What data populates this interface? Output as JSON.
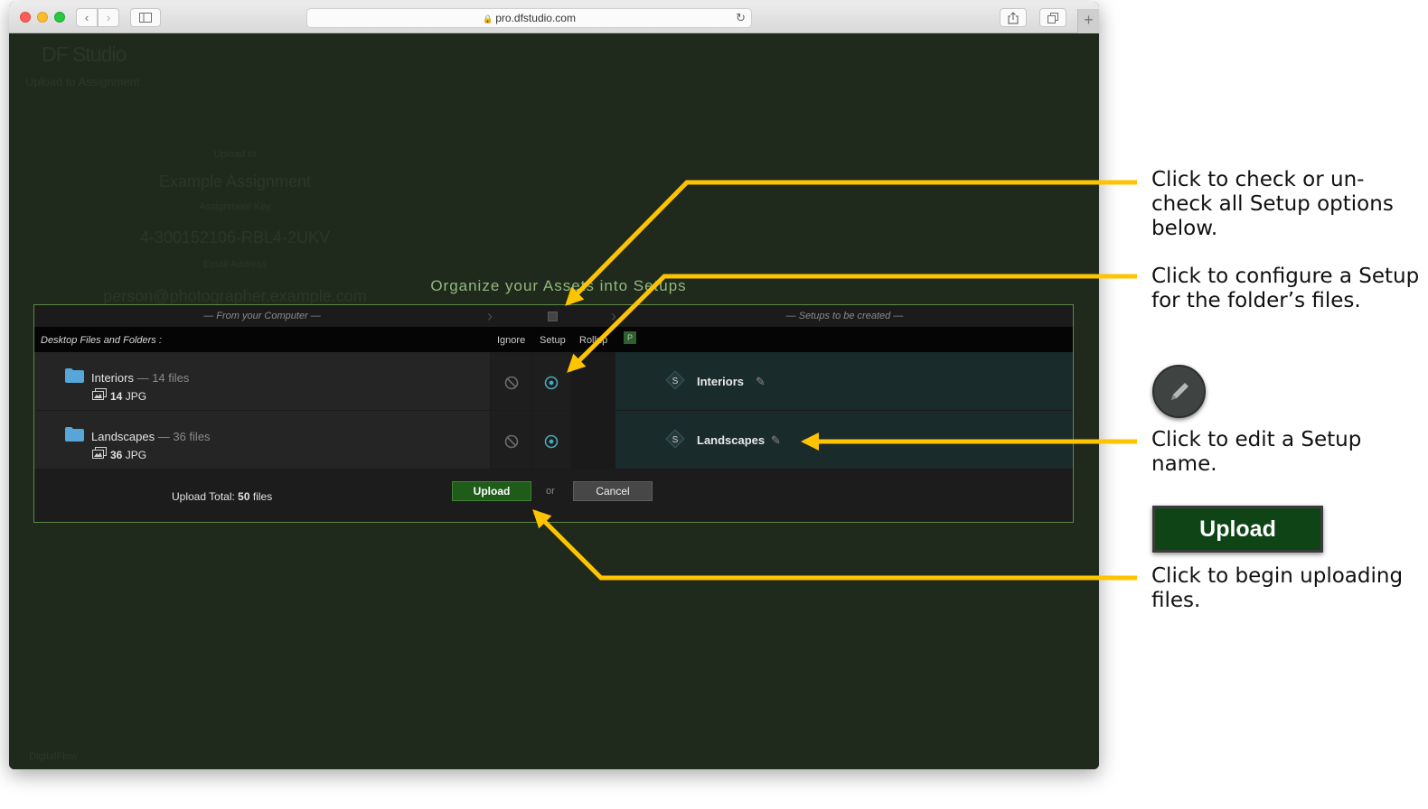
{
  "browser": {
    "url": "pro.dfstudio.com",
    "lock_icon": "lock-icon",
    "reload_icon": "reload-icon"
  },
  "background": {
    "logo": "DF Studio",
    "subtitle": "Upload to Assignment",
    "line_a": "Upload to",
    "line_b": "Example Assignment",
    "line_c": "Assignment Key",
    "line_d": "4-300152106-RBL4-2UKV",
    "line_e": "Email Address",
    "line_f": "person@photographer.example.com",
    "footer": "DigitalFlow"
  },
  "dialog": {
    "title": "Organize your Assets into Setups",
    "from_label": "— From your Computer —",
    "setups_label": "— Setups to be created —",
    "desktop_label": "Desktop Files and Folders :",
    "col_ignore": "Ignore",
    "col_setup": "Setup",
    "col_rollup": "Rollup",
    "p_badge": "P",
    "rows": [
      {
        "folder": "Interiors",
        "count": "— 14 files",
        "file_count": "14",
        "file_type": "JPG",
        "setup_name": "Interiors"
      },
      {
        "folder": "Landscapes",
        "count": "— 36 files",
        "file_count": "36",
        "file_type": "JPG",
        "setup_name": "Landscapes"
      }
    ],
    "upload_total_label": "Upload Total:",
    "upload_total_value": "50",
    "upload_total_unit": "files",
    "upload_button": "Upload",
    "or": "or",
    "cancel_button": "Cancel"
  },
  "annotations": {
    "check_all": "Click to check or un-check all Setup options below.",
    "configure": "Click to configure a Setup for the folder’s files.",
    "edit_name": "Click to edit a Setup name.",
    "begin_upload": "Click to begin uploading files.",
    "upload_sample": "Upload"
  },
  "colors": {
    "page_bg": "#1f2a1d",
    "accent_green": "#1f5c1a",
    "title_green": "#93b87e",
    "setup_teal": "#1a2b2c",
    "arrow_yellow": "#ffc400"
  }
}
